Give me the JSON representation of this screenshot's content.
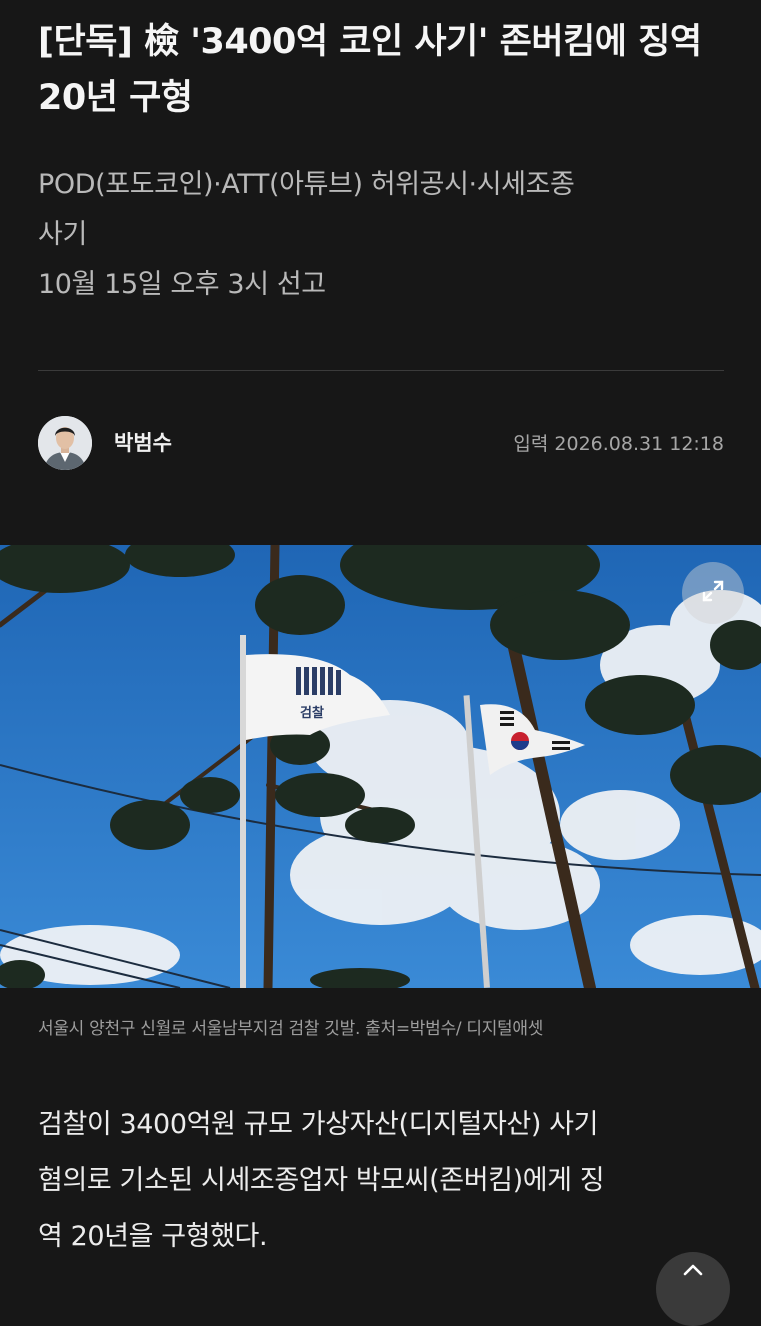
{
  "article": {
    "headline": "[단독] 檢 '3400억 코인 사기' 존버킴에 징역 20년 구형",
    "subtitle_lines": [
      "POD(포도코인)·ATT(아튜브) 허위공시·시세조종",
      "사기",
      "10월 15일 오후 3시 선고"
    ],
    "author": "박범수",
    "published": "입력 2026.08.31 12:18",
    "photo_caption": "서울시 양천구 신월로 서울남부지검 검찰 깃발. 출처=박범수/ 디지털애셋",
    "flag_text": "검찰",
    "body_lines": [
      "검찰이 3400억원 규모 가상자산(디지털자산) 사기",
      "혐의로 기소된 시세조종업자 박모씨(존버킴)에게 징",
      "역 20년을 구형했다."
    ]
  },
  "icons": {
    "expand": "expand-icon",
    "scroll_top": "chevron-up-icon"
  },
  "colors": {
    "background": "#171717",
    "sky": "#2a74bf"
  }
}
